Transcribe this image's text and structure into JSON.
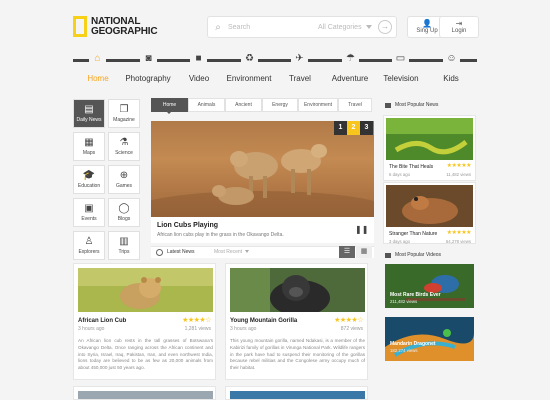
{
  "brand": {
    "line1": "NATIONAL",
    "line2": "GEOGRAPHIC",
    "color": "#f7d117"
  },
  "search": {
    "placeholder": "Search",
    "category": "All Categories"
  },
  "header_buttons": {
    "signup": "Sing Up",
    "login": "Login"
  },
  "nav": [
    {
      "label": "Home",
      "icon": "home-icon",
      "active": true
    },
    {
      "label": "Photography",
      "icon": "camera-icon"
    },
    {
      "label": "Video",
      "icon": "video-camera-icon"
    },
    {
      "label": "Environment",
      "icon": "recycle-icon"
    },
    {
      "label": "Travel",
      "icon": "airplane-icon"
    },
    {
      "label": "Adventure",
      "icon": "parachute-icon"
    },
    {
      "label": "Television",
      "icon": "tv-icon"
    },
    {
      "label": "Kids",
      "icon": "kids-icon"
    }
  ],
  "sidebar": [
    {
      "label": "Daily News",
      "icon": "newspaper-icon",
      "active": true
    },
    {
      "label": "Magazine",
      "icon": "magazine-icon"
    },
    {
      "label": "Maps",
      "icon": "map-icon"
    },
    {
      "label": "Science",
      "icon": "flask-icon"
    },
    {
      "label": "Education",
      "icon": "graduation-cap-icon"
    },
    {
      "label": "Games",
      "icon": "gamepad-icon"
    },
    {
      "label": "Events",
      "icon": "calendar-icon"
    },
    {
      "label": "Blogs",
      "icon": "chat-bubble-icon"
    },
    {
      "label": "Explorers",
      "icon": "explorer-icon"
    },
    {
      "label": "Trips",
      "icon": "suitcase-icon"
    }
  ],
  "tabs": [
    "Home",
    "Animals",
    "Ancient",
    "Energy",
    "Environment",
    "Travel"
  ],
  "hero": {
    "pages": [
      "1",
      "2",
      "3"
    ],
    "active_page": "2",
    "title": "Lion Cubs Playing",
    "description": "African lion cubs play in the grass in the Okavango Delta."
  },
  "latest": {
    "label": "Latest News",
    "sort": "Most Recent"
  },
  "cards": [
    {
      "title": "African Lion Cub",
      "ago": "3 hours ago",
      "views": "1,281 views",
      "stars": "★★★★☆",
      "body": "An African lion cub rests in the tall grasses of Botswana's Okavango Delta. Once ranging across the African continent and into Syria, Israel, Iraq, Pakistan, Iran, and even northwest India, lions today are believed to be as few as 20,000 animals from about 450,000 just 50 years ago."
    },
    {
      "title": "Young Mountain Gorilla",
      "ago": "3 hours ago",
      "views": "872 views",
      "stars": "★★★★☆",
      "body": "This young mountain gorilla, named Ndakasi, is a member of the Kabirizi family of gorillas in Virunga National Park. Wildlife rangers in the park have had to suspend their monitoring of the gorillas because rebel militias and the Congolese army occupy much of their habitat."
    }
  ],
  "popular_news": {
    "heading": "Most Popular News",
    "items": [
      {
        "title": "The Bite That Heals",
        "ago": "6 days ago",
        "views": "11,482 views",
        "stars": "★★★★★"
      },
      {
        "title": "Stranger Than Nature",
        "ago": "3 days ago",
        "views": "64,278 views",
        "stars": "★★★★★"
      }
    ]
  },
  "popular_videos": {
    "heading": "Most Popular Videos",
    "items": [
      {
        "title": "Most Rare Birds Ever",
        "views": "211,482 views"
      },
      {
        "title": "Mandarin Dragonet",
        "views": "182,274 views"
      }
    ]
  }
}
